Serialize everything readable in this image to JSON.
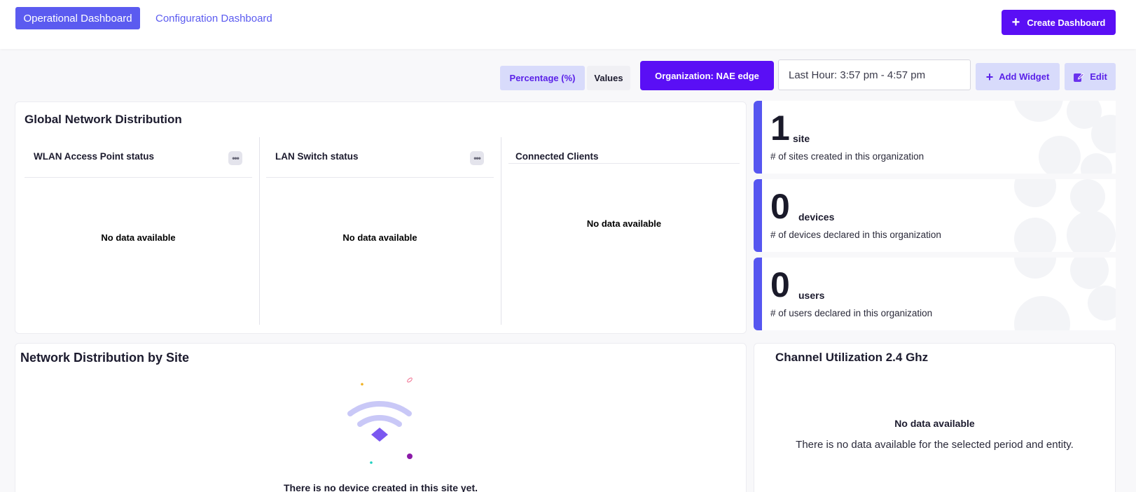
{
  "tabs": {
    "active_label": "Operational Dashboard",
    "other_label": "Configuration Dashboard"
  },
  "toolbar": {
    "create_label": "Create Dashboard",
    "percentage_label": "Percentage (%)",
    "values_label": "Values",
    "organization_label": "Organization: NAE edge",
    "time_range": "Last Hour: 3:57 pm - 4:57 pm",
    "add_widget_label": "Add Widget",
    "edit_label": "Edit"
  },
  "global_network": {
    "title": "Global Network Distribution",
    "columns": [
      {
        "title": "WLAN Access Point status",
        "message": "No data available"
      },
      {
        "title": "LAN Switch status",
        "message": "No data available"
      },
      {
        "title": "Connected Clients",
        "message": "No data available"
      }
    ]
  },
  "stats": [
    {
      "value": "1",
      "unit": "site",
      "description": "# of sites created in this organization"
    },
    {
      "value": "0",
      "unit": "devices",
      "description": "# of devices declared in this organization"
    },
    {
      "value": "0",
      "unit": "users",
      "description": "# of users declared in this organization"
    }
  ],
  "site_distribution": {
    "title": "Network Distribution by Site",
    "message": "There is no device created in this site yet."
  },
  "channel_utilization": {
    "title": "Channel Utilization 2.4 Ghz",
    "no_data": "No data available",
    "subtitle": "There is no data available for the selected period and entity."
  },
  "colors": {
    "primary": "#5a0ff5",
    "accent": "#5b5bf0",
    "light_accent": "#d8dbfb"
  }
}
